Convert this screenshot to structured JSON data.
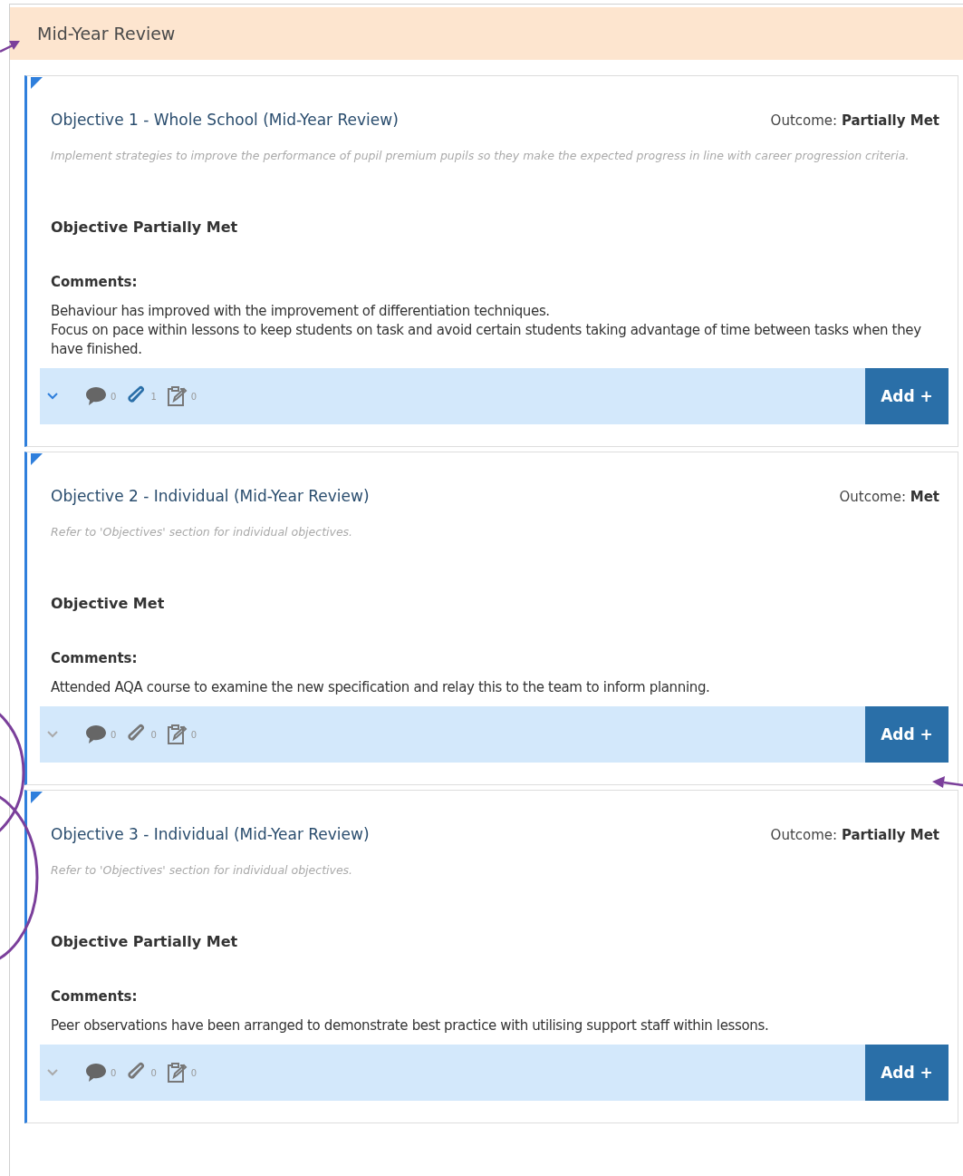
{
  "section": {
    "title": "Mid-Year Review"
  },
  "objectives": [
    {
      "title": "Objective 1 - Whole School (Mid-Year Review)",
      "outcome_label": "Outcome:",
      "outcome": "Partially Met",
      "description": "Implement strategies to improve the performance of pupil premium pupils so they make the expected progress in line with career progression criteria.",
      "status": "Objective Partially Met",
      "comments_label": "Comments:",
      "comments": [
        "Behaviour has improved with the improvement of differentiation techniques.",
        "Focus on pace within lessons to keep students on task and avoid certain students taking advantage of time between tasks when they have finished."
      ],
      "expand_enabled": true,
      "counters": [
        {
          "kind": "comment",
          "count": "0",
          "active": false
        },
        {
          "kind": "attachment",
          "count": "1",
          "active": true
        },
        {
          "kind": "task",
          "count": "0",
          "active": false
        }
      ],
      "add_button": "Add +"
    },
    {
      "title": "Objective 2 - Individual (Mid-Year Review)",
      "outcome_label": "Outcome:",
      "outcome": "Met",
      "description": "Refer to 'Objectives' section for individual objectives.",
      "status": "Objective Met",
      "comments_label": "Comments:",
      "comments": [
        "Attended AQA course to examine the new specification and relay this to the team to inform planning."
      ],
      "expand_enabled": false,
      "counters": [
        {
          "kind": "comment",
          "count": "0",
          "active": false
        },
        {
          "kind": "attachment",
          "count": "0",
          "active": false
        },
        {
          "kind": "task",
          "count": "0",
          "active": false
        }
      ],
      "add_button": "Add +"
    },
    {
      "title": "Objective 3 - Individual (Mid-Year Review)",
      "outcome_label": "Outcome:",
      "outcome": "Partially Met",
      "description": "Refer to 'Objectives' section for individual objectives.",
      "status": "Objective Partially Met",
      "comments_label": "Comments:",
      "comments": [
        "Peer observations have been arranged to demonstrate best practice with utilising support staff within lessons."
      ],
      "expand_enabled": false,
      "counters": [
        {
          "kind": "comment",
          "count": "0",
          "active": false
        },
        {
          "kind": "attachment",
          "count": "0",
          "active": false
        },
        {
          "kind": "task",
          "count": "0",
          "active": false
        }
      ],
      "add_button": "Add +"
    }
  ]
}
